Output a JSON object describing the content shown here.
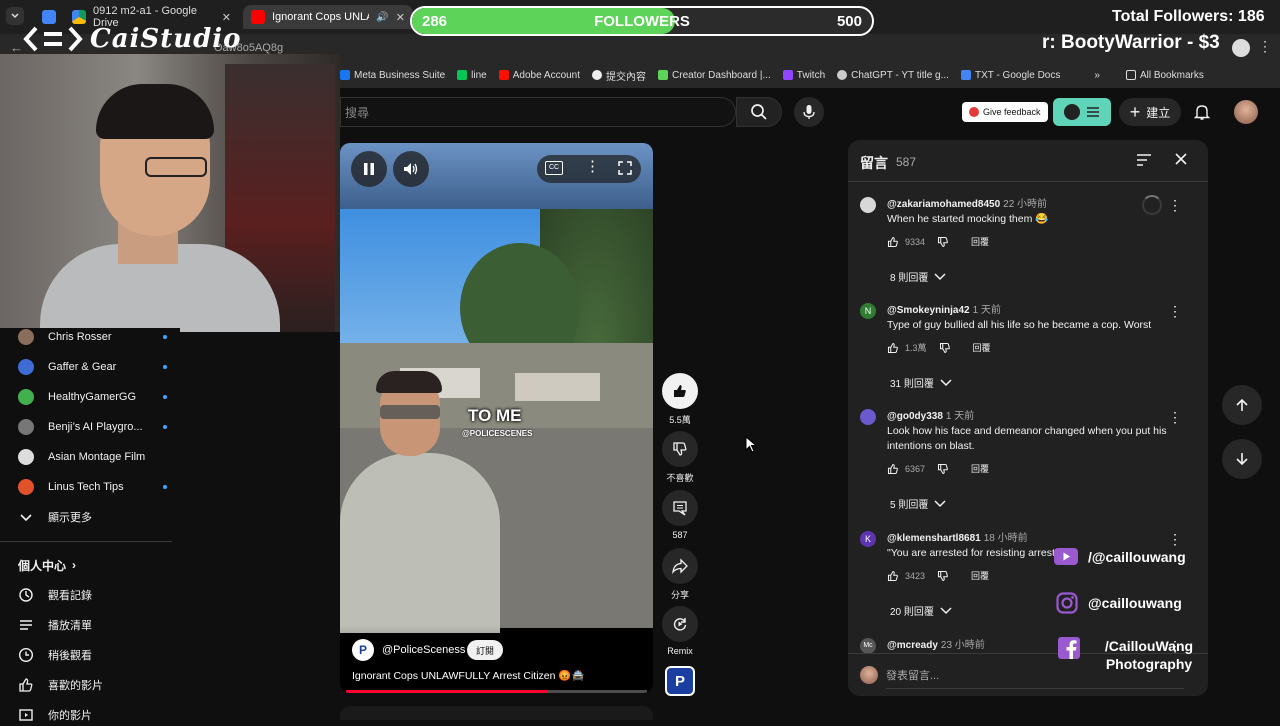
{
  "browser": {
    "tabs": [
      {
        "label": ""
      },
      {
        "label": "0912 m2-a1 - Google Drive"
      },
      {
        "label": "Ignorant Cops UNLAWFULL"
      }
    ],
    "url_fragment": "Oaw8o5AQ8g",
    "bookmarks": [
      {
        "label": "Meta Business Suite",
        "color": "#1877f2"
      },
      {
        "label": "line",
        "color": "#06c755"
      },
      {
        "label": "Adobe Account",
        "color": "#fa0f00"
      },
      {
        "label": "提交內容",
        "color": "#ffffff"
      },
      {
        "label": "Creator Dashboard |...",
        "color": "#5ed35a"
      },
      {
        "label": "Twitch",
        "color": "#9146ff"
      },
      {
        "label": "ChatGPT - YT title g...",
        "color": "#cccccc"
      },
      {
        "label": "TXT - Google Docs",
        "color": "#4285f4"
      }
    ],
    "all_bookmarks": "All Bookmarks"
  },
  "overlay": {
    "brand": "CaiStudio",
    "follower_bar": {
      "current": "286",
      "label": "FOLLOWERS",
      "goal": "500",
      "progress_fraction": 0.572
    },
    "total_followers": "Total Followers: 186",
    "donation": "r: BootyWarrior - $3",
    "social": [
      {
        "icon": "youtube-icon",
        "handle": "/@caillouwang"
      },
      {
        "icon": "instagram-icon",
        "handle": "@caillouwang"
      },
      {
        "icon": "facebook-icon",
        "handle": "/CaillouWang Photography"
      }
    ]
  },
  "sidebar": {
    "subscriptions": [
      {
        "label": "Chris Rosser",
        "color": "#8b6d5c"
      },
      {
        "label": "Gaffer & Gear",
        "color": "#3e6bd4"
      },
      {
        "label": "HealthyGamerGG",
        "color": "#41b04d"
      },
      {
        "label": "Benji’s AI Playgro...",
        "color": "#777"
      },
      {
        "label": "Asian Montage Film",
        "color": "#ddd"
      },
      {
        "label": "Linus Tech Tips",
        "color": "#e0522a"
      }
    ],
    "show_more": "顯示更多",
    "you_section": "個人中心",
    "you_items": [
      {
        "label": "觀看記錄",
        "icon": "history-icon"
      },
      {
        "label": "播放清單",
        "icon": "playlist-icon"
      },
      {
        "label": "稍後觀看",
        "icon": "clock-icon"
      },
      {
        "label": "喜歡的影片",
        "icon": "like-icon"
      },
      {
        "label": "你的影片",
        "icon": "video-icon"
      }
    ]
  },
  "topbar": {
    "search_placeholder": "搜尋",
    "feedback": "Give feedback",
    "create": "建立"
  },
  "video": {
    "caption_overlay": "TO ME",
    "watermark": "@POLICESCENES",
    "channel": "@PoliceSceness",
    "subscribe": "訂閱",
    "title": "Ignorant Cops UNLAWFULLY Arrest Citizen 😡🚔",
    "progress_fraction": 0.67
  },
  "actions": {
    "like_count": "5.5萬",
    "dislike": "不喜歡",
    "comments": "587",
    "share": "分享",
    "remix": "Remix"
  },
  "comments_panel": {
    "title": "留言",
    "count": "587",
    "input_placeholder": "發表留言...",
    "reply_label": "回覆",
    "items": [
      {
        "author": "@zakariamohamed8450",
        "time": "22 小時前",
        "text": "When he started mocking them 😂",
        "likes": "9334",
        "replies": "8 則回覆",
        "avatar_color": "#d8d8d8",
        "initial": ""
      },
      {
        "author": "@Smokeyninja42",
        "time": "1 天前",
        "text": "Type of guy bullied all his life so he became a cop. Worst",
        "likes": "1.3萬",
        "replies": "31 則回覆",
        "avatar_color": "#2e7d32",
        "initial": "N"
      },
      {
        "author": "@go0dy338",
        "time": "1 天前",
        "text": "Look how his face and demeanor changed when you put his intentions on blast.",
        "likes": "6367",
        "replies": "5 則回覆",
        "avatar_color": "#6a5acd",
        "initial": ""
      },
      {
        "author": "@klemenshartl8681",
        "time": "18 小時前",
        "text": "\"You are arrested for resisting arrest\"",
        "likes": "3423",
        "replies": "20 則回覆",
        "avatar_color": "#5e35b1",
        "initial": "K"
      },
      {
        "author": "@mcready",
        "time": "23 小時前",
        "text": "",
        "likes": "",
        "replies": "",
        "avatar_color": "#555",
        "initial": "Mc"
      }
    ]
  }
}
